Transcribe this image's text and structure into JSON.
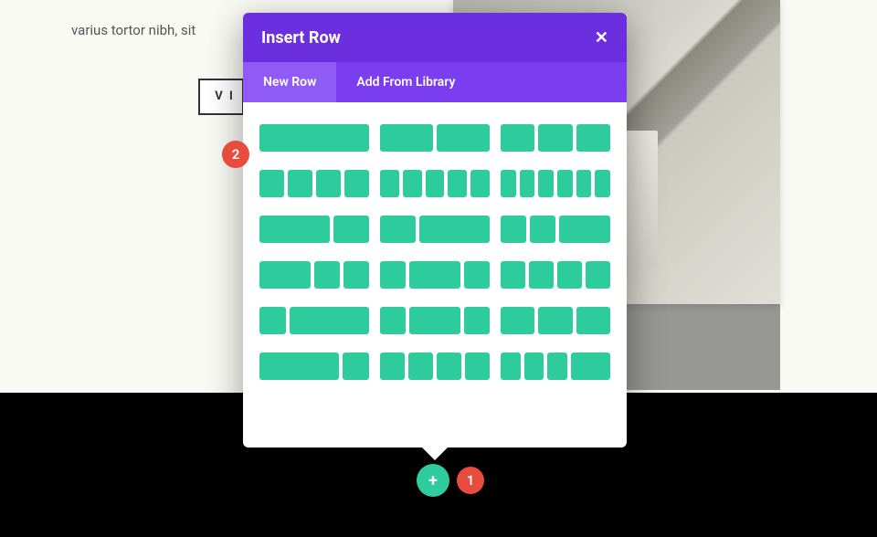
{
  "page": {
    "text_fragment": "varius tortor nibh, sit",
    "button_fragment": "V I"
  },
  "modal": {
    "title": "Insert Row",
    "tabs": {
      "new_row": "New Row",
      "add_from_library": "Add From Library"
    }
  },
  "layouts": {
    "r0c0": [
      1
    ],
    "r0c1": [
      1,
      1
    ],
    "r0c2": [
      1,
      1,
      1
    ],
    "r1c0": [
      1,
      1,
      1,
      1
    ],
    "r1c1": [
      1,
      1,
      1,
      1,
      1
    ],
    "r1c2": [
      1,
      1,
      1,
      1,
      1,
      1
    ],
    "r2c0": [
      2,
      1
    ],
    "r2c1": [
      1,
      2
    ],
    "r2c2": [
      1,
      1,
      2
    ],
    "r3c0": [
      2,
      1,
      1
    ],
    "r3c1": [
      1,
      2,
      1
    ],
    "r3c2": [
      1,
      1,
      1,
      1
    ],
    "r4c0": [
      1,
      3
    ],
    "r4c1": [
      1,
      2,
      1
    ],
    "r4c2": [
      1,
      1,
      1
    ],
    "r5c0": [
      3,
      1
    ],
    "r5c1": [
      1,
      1,
      1,
      1
    ],
    "r5c2": [
      1,
      1,
      1,
      2
    ]
  },
  "controls": {
    "add_icon": "+"
  },
  "markers": {
    "m1": "1",
    "m2": "2"
  }
}
